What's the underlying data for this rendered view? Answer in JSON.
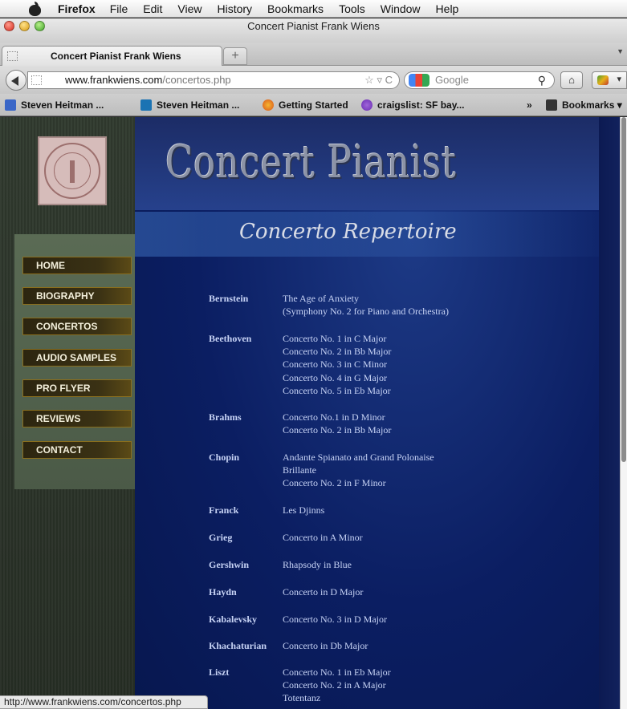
{
  "menubar": {
    "app": "Firefox",
    "items": [
      "File",
      "Edit",
      "View",
      "History",
      "Bookmarks",
      "Tools",
      "Window",
      "Help"
    ]
  },
  "window": {
    "title": "Concert Pianist Frank Wiens"
  },
  "tab": {
    "label": "Concert Pianist Frank Wiens",
    "new_tab": "+"
  },
  "urlbar": {
    "host": "www.frankwiens.com",
    "path": "/concertos.php"
  },
  "search": {
    "placeholder": "Google"
  },
  "bookmarks": {
    "items": [
      "Steven Heitman ...",
      "Steven Heitman ...",
      "Getting Started",
      "craigslist: SF bay..."
    ],
    "overflow": "»",
    "menu": "Bookmarks"
  },
  "site": {
    "title": "Concert Pianist",
    "subtitle": "Concerto Repertoire",
    "nav": [
      "HOME",
      "BIOGRAPHY",
      "CONCERTOS",
      "AUDIO SAMPLES",
      "PRO FLYER",
      "REVIEWS",
      "CONTACT"
    ],
    "repertoire": [
      {
        "composer": "Bernstein",
        "works": [
          "The Age of Anxiety",
          "(Symphony No. 2 for Piano and Orchestra)"
        ]
      },
      {
        "composer": "Beethoven",
        "works": [
          "Concerto No. 1 in C Major",
          "Concerto No. 2 in Bb Major",
          "Concerto No. 3 in C Minor",
          "Concerto No. 4 in G Major",
          "Concerto No. 5 in Eb Major"
        ]
      },
      {
        "composer": "Brahms",
        "works": [
          "Concerto No.1 in D Minor",
          "Concerto No. 2 in Bb Major"
        ]
      },
      {
        "composer": "Chopin",
        "works": [
          "Andante Spianato and Grand Polonaise",
          "Brillante",
          "Concerto No. 2 in F Minor"
        ]
      },
      {
        "composer": "Franck",
        "works": [
          "Les Djinns"
        ]
      },
      {
        "composer": "Grieg",
        "works": [
          "Concerto in A Minor"
        ]
      },
      {
        "composer": "Gershwin",
        "works": [
          "Rhapsody in Blue"
        ]
      },
      {
        "composer": "Haydn",
        "works": [
          "Concerto in D Major"
        ]
      },
      {
        "composer": "Kabalevsky",
        "works": [
          "Concerto No. 3 in D Major"
        ]
      },
      {
        "composer": "Khachaturian",
        "works": [
          "Concerto in Db Major"
        ]
      },
      {
        "composer": "Liszt",
        "works": [
          "Concerto No. 1 in Eb Major",
          "Concerto No. 2 in A Major",
          "Totentanz"
        ]
      }
    ]
  },
  "status": {
    "text": "http://www.frankwiens.com/concertos.php"
  }
}
